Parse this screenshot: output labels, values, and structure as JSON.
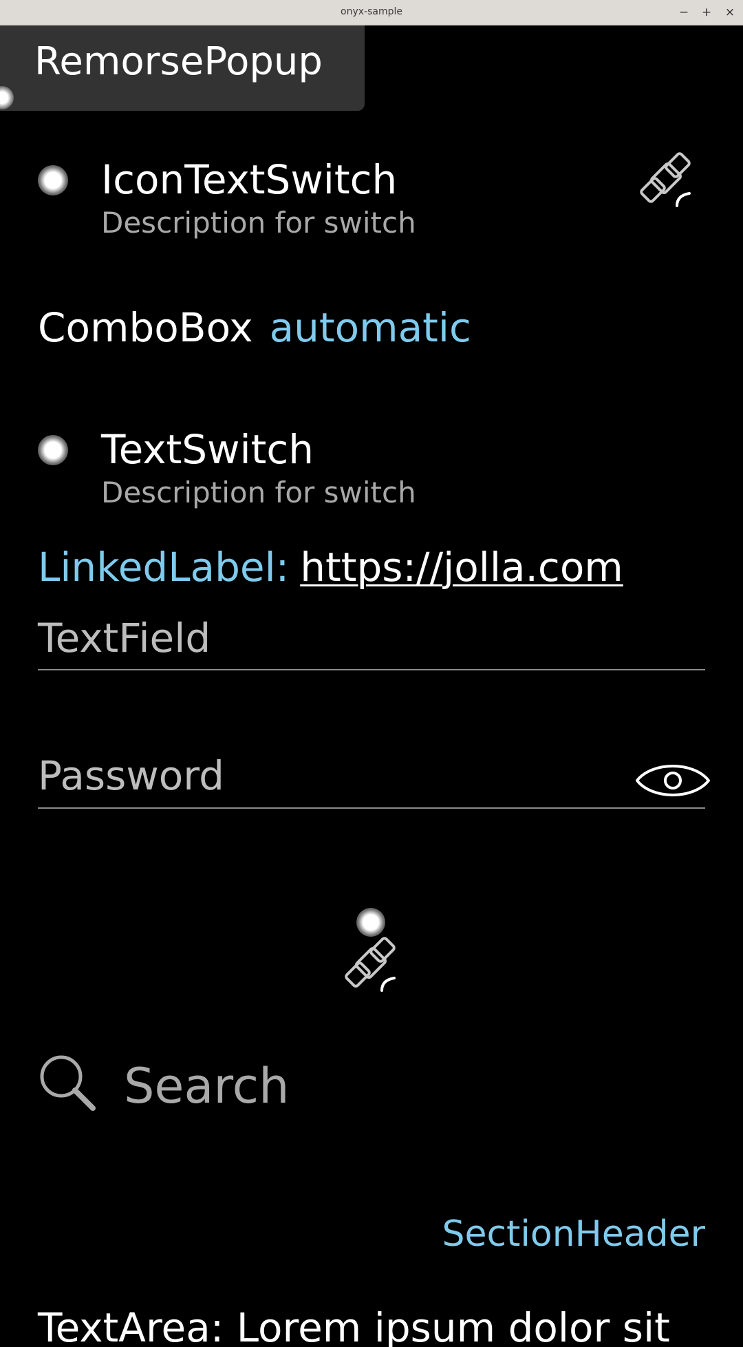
{
  "window": {
    "title": "onyx-sample",
    "minimize_label": "−",
    "maximize_label": "+",
    "close_label": "×"
  },
  "remorse_popup": {
    "label": "RemorsePopup"
  },
  "icon_text_switch": {
    "label": "IconTextSwitch",
    "description": "Description for switch",
    "icon": "satellite-icon"
  },
  "combo_box": {
    "label": "ComboBox",
    "value": "automatic"
  },
  "text_switch": {
    "label": "TextSwitch",
    "description": "Description for switch"
  },
  "linked_label": {
    "label": "LinkedLabel:",
    "link": "https://jolla.com"
  },
  "text_field": {
    "placeholder": "TextField"
  },
  "password_field": {
    "placeholder": "Password",
    "icon": "eye-icon"
  },
  "icon_button": {
    "icon": "satellite-icon"
  },
  "search_field": {
    "placeholder": "Search",
    "icon": "search-icon"
  },
  "section_header": {
    "label": "SectionHeader"
  },
  "text_area": {
    "text": "TextArea: Lorem ipsum dolor sit"
  },
  "colors": {
    "background": "#000000",
    "accent": "#7fcbed",
    "secondary_text": "#a9a9a9",
    "popup_background": "#333333"
  }
}
